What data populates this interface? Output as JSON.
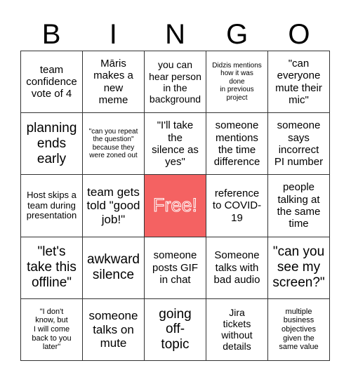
{
  "title_letters": [
    "B",
    "I",
    "N",
    "G",
    "O"
  ],
  "free_color": "#f46262",
  "rows": [
    [
      {
        "text": "team\nconfidence\nvote of 4",
        "size": "s-md"
      },
      {
        "text": "Māris\nmakes a\nnew\nmeme",
        "size": "s-md"
      },
      {
        "text": "you can\nhear person\nin the\nbackground",
        "size": "s-sm"
      },
      {
        "text": "Didzis mentions\nhow it was\ndone\nin previous\nproject",
        "size": "s-tiny"
      },
      {
        "text": "\"can\neveryone\nmute their\nmic\"",
        "size": "s-md"
      }
    ],
    [
      {
        "text": "planning\nends\nearly",
        "size": "s-xl"
      },
      {
        "text": "\"can you repeat\nthe question\"\nbecause they\nwere zoned out",
        "size": "s-tiny"
      },
      {
        "text": "\"I'll take\nthe\nsilence as\nyes\"",
        "size": "s-md"
      },
      {
        "text": "someone\nmentions\nthe time\ndifference",
        "size": "s-md"
      },
      {
        "text": "someone\nsays\nincorrect\nPI number",
        "size": "s-md"
      }
    ],
    [
      {
        "text": "Host skips a\nteam during\npresentation",
        "size": "s-xs"
      },
      {
        "text": "team gets\ntold \"good\njob!\"",
        "size": "s-lg"
      },
      {
        "text": "Free!",
        "size": "free",
        "free": true
      },
      {
        "text": "reference\nto COVID-\n19",
        "size": "s-md"
      },
      {
        "text": "people\ntalking at\nthe same\ntime",
        "size": "s-md"
      }
    ],
    [
      {
        "text": "\"let's\ntake this\noffline\"",
        "size": "s-xl"
      },
      {
        "text": "awkward\nsilence",
        "size": "s-xl"
      },
      {
        "text": "someone\nposts GIF\nin chat",
        "size": "s-md"
      },
      {
        "text": "Someone\ntalks with\nbad audio",
        "size": "s-md"
      },
      {
        "text": "\"can you\nsee my\nscreen?\"",
        "size": "s-xl"
      }
    ],
    [
      {
        "text": "\"I don't\nknow, but\nI will come\nback to you\nlater\"",
        "size": "s-xxs"
      },
      {
        "text": "someone\ntalks on\nmute",
        "size": "s-lg"
      },
      {
        "text": "going\noff-\ntopic",
        "size": "s-xl"
      },
      {
        "text": "Jira\ntickets\nwithout\ndetails",
        "size": "s-sm"
      },
      {
        "text": "multiple\nbusiness\nobjectives\ngiven the\nsame value",
        "size": "s-xxs"
      }
    ]
  ]
}
